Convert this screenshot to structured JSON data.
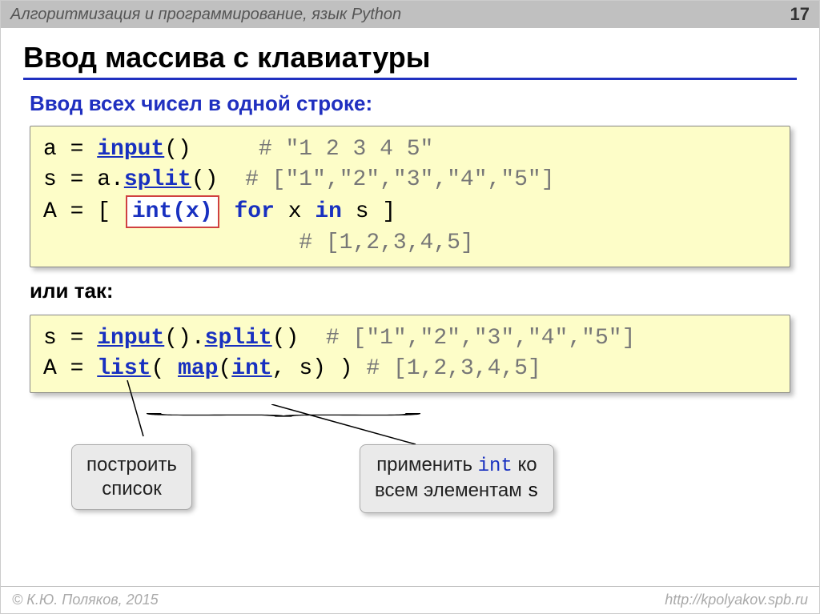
{
  "header": {
    "breadcrumb": "Алгоритмизация и программирование, язык Python",
    "page": "17"
  },
  "title": "Ввод массива с клавиатуры",
  "subtitle": "Ввод всех чисел в одной строке:",
  "code1": {
    "l1a": "a",
    "l1eq": " = ",
    "l1fn": "input",
    "l1b": "()     ",
    "l1cm": "# \"1 2 3 4 5\"",
    "l2a": "s",
    "l2eq": " = ",
    "l2b": "a.",
    "l2fn": "split",
    "l2c": "()  ",
    "l2cm": "# [\"1\",\"2\",\"3\",\"4\",\"5\"]",
    "l3a": "A",
    "l3eq": " = ",
    "l3b": "[ ",
    "l3hl": "int(x)",
    "l3c": " ",
    "l3kw": "for",
    "l3d": " x ",
    "l3kw2": "in",
    "l3e": " s ]",
    "l4pad": "                   ",
    "l4cm": "# [1,2,3,4,5]"
  },
  "ortext": "или так:",
  "code2": {
    "l1a": "s",
    "l1eq": " = ",
    "l1fn1": "input",
    "l1b": "().",
    "l1fn2": "split",
    "l1c": "()  ",
    "l1cm": "# [\"1\",\"2\",\"3\",\"4\",\"5\"]",
    "l2a": "A",
    "l2eq": " = ",
    "l2fn1": "list",
    "l2b": "( ",
    "l2fn2": "map",
    "l2c": "(",
    "l2fn3": "int",
    "l2d": ", s) ) ",
    "l2cm": "# [1,2,3,4,5]"
  },
  "callout1": {
    "line1": "построить",
    "line2": "список"
  },
  "callout2": {
    "part1": "применить ",
    "fn": "int",
    "part2": " ко",
    "line2a": "всем элементам ",
    "var": "s"
  },
  "footer": {
    "left": "© К.Ю. Поляков, 2015",
    "right": "http://kpolyakov.spb.ru"
  }
}
